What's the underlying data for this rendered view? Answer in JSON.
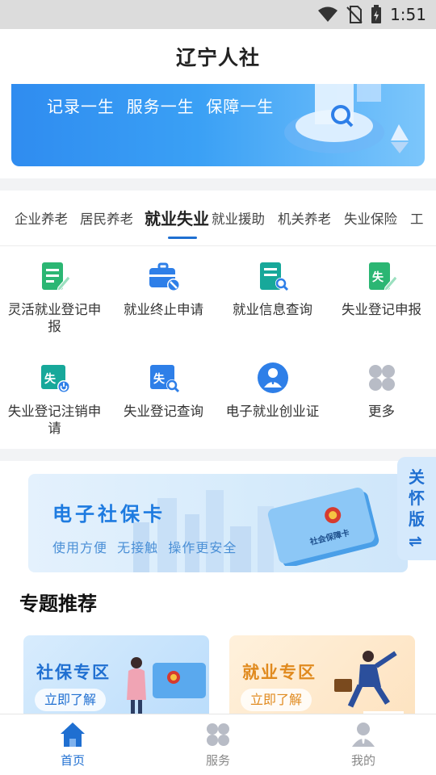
{
  "status_bar": {
    "time": "1:51"
  },
  "header": {
    "title": "辽宁人社"
  },
  "top_banner": {
    "slogan": "记录一生  服务一生  保障一生"
  },
  "tabs": [
    {
      "label": "企业养老"
    },
    {
      "label": "居民养老"
    },
    {
      "label": "就业失业",
      "active": true
    },
    {
      "label": "就业援助"
    },
    {
      "label": "机关养老"
    },
    {
      "label": "失业保险"
    },
    {
      "label": "工"
    }
  ],
  "services": [
    {
      "label": "灵活就业登记申报",
      "icon": "document-edit-icon"
    },
    {
      "label": "就业终止申请",
      "icon": "briefcase-stop-icon"
    },
    {
      "label": "就业信息查询",
      "icon": "document-search-icon"
    },
    {
      "label": "失业登记申报",
      "icon": "unemployment-edit-icon"
    },
    {
      "label": "失业登记注销申请",
      "icon": "unemployment-cancel-icon"
    },
    {
      "label": "失业登记查询",
      "icon": "unemployment-search-icon"
    },
    {
      "label": "电子就业创业证",
      "icon": "person-badge-icon"
    },
    {
      "label": "更多",
      "icon": "more-grid-icon"
    }
  ],
  "card_banner": {
    "title": "电子社保卡",
    "subtitle": "使用方便  无接触  操作更安全",
    "card_text": "社会保障卡"
  },
  "care_mode": {
    "label": "关怀版",
    "switch_symbol": "⇌"
  },
  "section": {
    "title": "专题推荐"
  },
  "topics": [
    {
      "title": "社保专区",
      "button": "立即了解",
      "color": "#1f6fd1"
    },
    {
      "title": "就业专区",
      "button": "立即了解",
      "color": "#e08a1e"
    }
  ],
  "bottom_nav": [
    {
      "label": "首页",
      "icon": "home-icon",
      "active": true
    },
    {
      "label": "服务",
      "icon": "services-icon"
    },
    {
      "label": "我的",
      "icon": "profile-icon"
    }
  ],
  "colors": {
    "accent": "#1f6fd1",
    "service_green": "#2bb673",
    "service_blue": "#2e7fe8"
  }
}
